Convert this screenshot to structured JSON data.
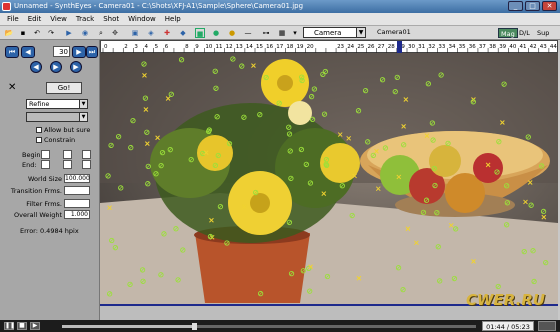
{
  "window": {
    "title": "Unnamed - SynthEyes - Camera01 - C:\\Shots\\XFJ-A1\\Sample\\Sphere\\Camera01.jpg"
  },
  "menu": [
    "File",
    "Edit",
    "View",
    "Track",
    "Shot",
    "Window",
    "Help"
  ],
  "toolbar": {
    "camera_select": "Camera",
    "camera_name": "Camera01",
    "mag_label": "Mag",
    "dl_label": "D/L",
    "sup_label": "Sup"
  },
  "timeline": {
    "ticks": [
      "0",
      "",
      "2",
      "3",
      "4",
      "5",
      "6",
      "",
      "8",
      "9",
      "10",
      "11",
      "12",
      "13",
      "14",
      "15",
      "16",
      "17",
      "18",
      "19",
      "20",
      "",
      "",
      "23",
      "24",
      "25",
      "26",
      "27",
      "28",
      "29",
      "30",
      "31",
      "32",
      "33",
      "34",
      "35",
      "36",
      "37",
      "38",
      "39",
      "40",
      "41",
      "42",
      "43",
      "44"
    ],
    "current_fraction": 0.65
  },
  "panel": {
    "frame_value": "30",
    "go_label": "Go!",
    "method_select": "Refine",
    "second_select": "",
    "allow_label": "Allow but sure",
    "constrain_label": "Constrain",
    "begin_label": "Begin:",
    "end_label": "End:",
    "world_size_label": "World Size",
    "world_size_value": "100.000",
    "transition_label": "Transition Frms.",
    "filter_label": "Filter Frms.",
    "overall_weight_label": "Overall Weight",
    "overall_weight_value": "1.000",
    "error_text": "Error:   0.4984 hpix"
  },
  "player": {
    "time": "01:44 / 05:23",
    "progress": 0.32
  },
  "watermark": "CWER.RU",
  "colors": {
    "accent": "#2d63a8",
    "tracker_green": "#9be03a",
    "tracker_yellow": "#f0d230",
    "timeline_marker": "#1e2a8c"
  }
}
